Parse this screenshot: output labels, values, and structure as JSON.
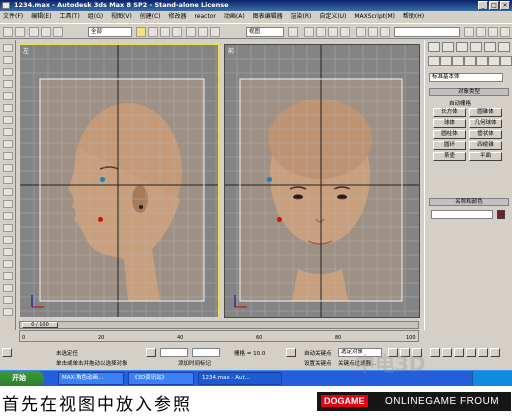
{
  "window": {
    "title": "1234.max - Autodesk 3ds Max 8 SP2 - Stand-alone License"
  },
  "menu": [
    "文件(F)",
    "编辑(E)",
    "工具(T)",
    "组(G)",
    "视图(V)",
    "创建(C)",
    "修改器",
    "reactor",
    "动画(A)",
    "图表编辑器",
    "渲染(R)",
    "自定义(U)",
    "MAXScript(M)",
    "帮助(H)"
  ],
  "toolbar": {
    "selection_filter": "全部",
    "ref_coord": "视图"
  },
  "viewports": {
    "left_label": "左",
    "right_label": "前"
  },
  "command_panel": {
    "dropdown": "标准基本体",
    "object_type_title": "对象类型",
    "autogrid": "自动栅格",
    "buttons": [
      "长方体",
      "圆锥体",
      "球体",
      "几何球体",
      "圆柱体",
      "管状体",
      "圆环",
      "四棱锥",
      "茶壶",
      "平面"
    ],
    "name_color_title": "名称和颜色"
  },
  "timeline": {
    "frame": "0 / 100",
    "ticks": [
      "0",
      "20",
      "40",
      "60",
      "80",
      "100"
    ]
  },
  "status": {
    "selection": "未选定任",
    "prompt": "单击或单击并拖动以选择对象",
    "add_tag": "添加时间标记",
    "grid": "栅格 = 10.0",
    "autokey": "自动关键点",
    "selected_set": "选定对象",
    "set_key": "设置关键点",
    "key_filters": "关键点过滤器..."
  },
  "taskbar": {
    "start": "开始",
    "tasks": [
      "MAX-角色动画...",
      "《3D资讯站》",
      "1234.max - Aut..."
    ]
  },
  "caption": "首先在视图中放入参照",
  "branding": {
    "a": "DOGAME",
    "b": "ONLINEGAME FROUM",
    "watermark": "中电3D"
  },
  "colors": {
    "active_border": "#f0e050",
    "title_start": "#0a246a",
    "object_color": "#7a1c2c"
  }
}
